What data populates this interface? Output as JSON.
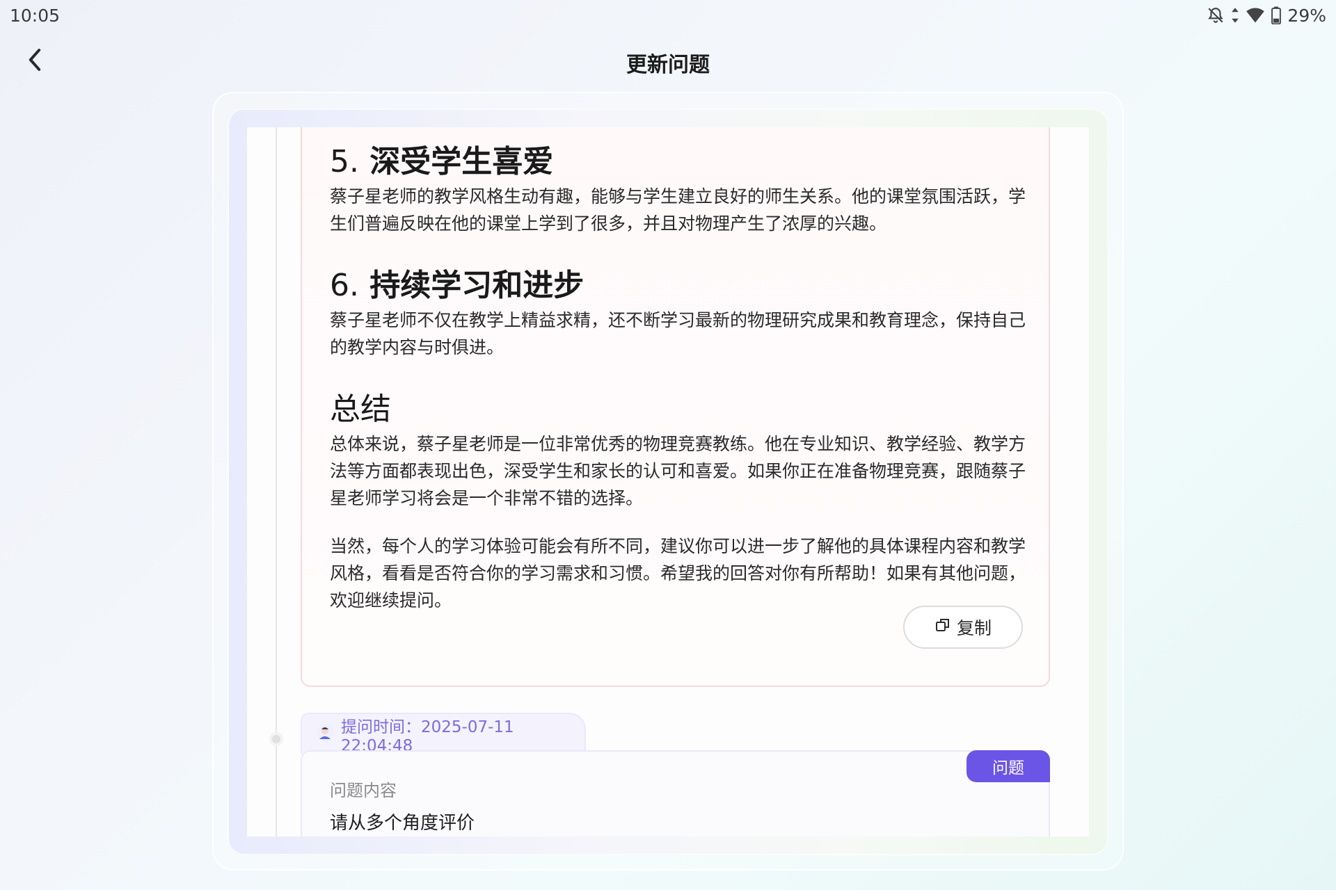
{
  "status_bar": {
    "time": "10:05",
    "battery": "29%",
    "icons": [
      "bell-off-icon",
      "data-arrows-icon",
      "wifi-icon",
      "battery-icon"
    ]
  },
  "header": {
    "title": "更新问题",
    "back_icon": "chevron-left-icon"
  },
  "answer": {
    "sections": [
      {
        "num": "5.",
        "heading": "深受学生喜爱",
        "text": "蔡子星老师的教学风格生动有趣，能够与学生建立良好的师生关系。他的课堂氛围活跃，学生们普遍反映在他的课堂上学到了很多，并且对物理产生了浓厚的兴趣。"
      },
      {
        "num": "6.",
        "heading": "持续学习和进步",
        "text": "蔡子星老师不仅在教学上精益求精，还不断学习最新的物理研究成果和教育理念，保持自己的教学内容与时俱进。"
      }
    ],
    "summary_heading": "总结",
    "summary_text": "总体来说，蔡子星老师是一位非常优秀的物理竞赛教练。他在专业知识、教学经验、教学方法等方面都表现出色，深受学生和家长的认可和喜爱。如果你正在准备物理竞赛，跟随蔡子星老师学习将会是一个非常不错的选择。",
    "closing_text": "当然，每个人的学习体验可能会有所不同，建议你可以进一步了解他的具体课程内容和教学风格，看看是否符合你的学习需求和习惯。希望我的回答对你有所帮助！如果有其他问题，欢迎继续提问。",
    "copy_label": "复制",
    "copy_icon": "copy-icon"
  },
  "question": {
    "time_label": "提问时间：2025-07-11 22:04:48",
    "avatar_icon": "user-avatar-icon",
    "badge": "问题",
    "content_label": "问题内容",
    "content": "请从多个角度评价"
  }
}
